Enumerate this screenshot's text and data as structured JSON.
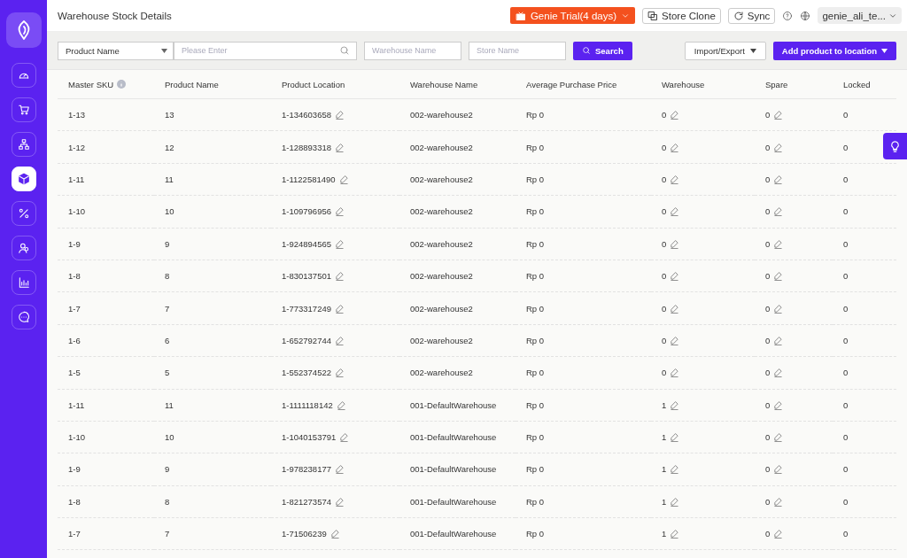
{
  "sidebar": {
    "items": [
      {
        "kind": "dashboard",
        "selected": false
      },
      {
        "kind": "cart",
        "selected": false
      },
      {
        "kind": "sitemap",
        "selected": false
      },
      {
        "kind": "cube",
        "selected": true
      },
      {
        "kind": "percent",
        "selected": false
      },
      {
        "kind": "user",
        "selected": false
      },
      {
        "kind": "chart",
        "selected": false
      },
      {
        "kind": "chat",
        "selected": false
      }
    ]
  },
  "header": {
    "title": "Warehouse Stock Details",
    "trial": "Genie Trial(4 days)",
    "store_clone": "Store Clone",
    "sync": "Sync",
    "account": "genie_ali_te..."
  },
  "filters": {
    "field_select": "Product Name",
    "search_placeholder": "Please Enter",
    "warehouse_placeholder": "Warehouse Name",
    "store_placeholder": "Store Name",
    "search_button": "Search",
    "import_export": "Import/Export",
    "add_product": "Add product to location"
  },
  "table": {
    "columns": [
      {
        "label": "Master SKU",
        "kind": "info"
      },
      {
        "label": "Product Name",
        "kind": "text"
      },
      {
        "label": "Product Location",
        "kind": "editable"
      },
      {
        "label": "Warehouse Name",
        "kind": "text"
      },
      {
        "label": "Average Purchase Price",
        "kind": "text"
      },
      {
        "label": "Warehouse",
        "kind": "editable"
      },
      {
        "label": "Spare",
        "kind": "editable"
      },
      {
        "label": "Locked",
        "kind": "text"
      }
    ],
    "rows": [
      [
        "1-13",
        "13",
        "1-134603658",
        "002-warehouse2",
        "Rp 0",
        "0",
        "0",
        "0"
      ],
      [
        "1-12",
        "12",
        "1-128893318",
        "002-warehouse2",
        "Rp 0",
        "0",
        "0",
        "0"
      ],
      [
        "1-11",
        "11",
        "1-1122581490",
        "002-warehouse2",
        "Rp 0",
        "0",
        "0",
        "0"
      ],
      [
        "1-10",
        "10",
        "1-109796956",
        "002-warehouse2",
        "Rp 0",
        "0",
        "0",
        "0"
      ],
      [
        "1-9",
        "9",
        "1-924894565",
        "002-warehouse2",
        "Rp 0",
        "0",
        "0",
        "0"
      ],
      [
        "1-8",
        "8",
        "1-830137501",
        "002-warehouse2",
        "Rp 0",
        "0",
        "0",
        "0"
      ],
      [
        "1-7",
        "7",
        "1-773317249",
        "002-warehouse2",
        "Rp 0",
        "0",
        "0",
        "0"
      ],
      [
        "1-6",
        "6",
        "1-652792744",
        "002-warehouse2",
        "Rp 0",
        "0",
        "0",
        "0"
      ],
      [
        "1-5",
        "5",
        "1-552374522",
        "002-warehouse2",
        "Rp 0",
        "0",
        "0",
        "0"
      ],
      [
        "1-11",
        "11",
        "1-1111118142",
        "001-DefaultWarehouse",
        "Rp 0",
        "1",
        "0",
        "0"
      ],
      [
        "1-10",
        "10",
        "1-1040153791",
        "001-DefaultWarehouse",
        "Rp 0",
        "1",
        "0",
        "0"
      ],
      [
        "1-9",
        "9",
        "1-978238177",
        "001-DefaultWarehouse",
        "Rp 0",
        "1",
        "0",
        "0"
      ],
      [
        "1-8",
        "8",
        "1-821273574",
        "001-DefaultWarehouse",
        "Rp 0",
        "1",
        "0",
        "0"
      ],
      [
        "1-7",
        "7",
        "1-71506239",
        "001-DefaultWarehouse",
        "Rp 0",
        "1",
        "0",
        "0"
      ]
    ]
  }
}
